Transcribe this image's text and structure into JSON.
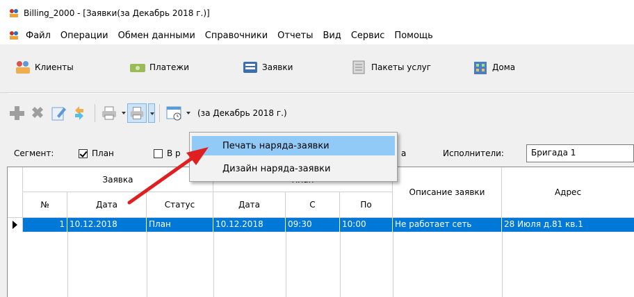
{
  "window": {
    "title": "Billing_2000 - [Заявки(за Декабрь 2018 г.)]"
  },
  "menu": [
    "Файл",
    "Операции",
    "Обмен данными",
    "Справочники",
    "Отчеты",
    "Вид",
    "Сервис",
    "Помощь"
  ],
  "mainbar": [
    {
      "label": "Клиенты",
      "icon": "clients-icon"
    },
    {
      "label": "Платежи",
      "icon": "payments-icon"
    },
    {
      "label": "Заявки",
      "icon": "requests-icon"
    },
    {
      "label": "Пакеты услуг",
      "icon": "service-packages-icon"
    },
    {
      "label": "Дома",
      "icon": "houses-icon"
    }
  ],
  "toolbar": {
    "period": "(за Декабрь 2018 г.)"
  },
  "filter": {
    "segment_label": "Сегмент:",
    "plan_label": "План",
    "plan_checked": true,
    "second_label": "В р",
    "second_checked": false,
    "partial_right": "а",
    "executors_label": "Исполнители:",
    "executors_value": "Бригада 1"
  },
  "popup": {
    "items": [
      "Печать наряда-заявки",
      "Дизайн наряда-заявки"
    ],
    "highlighted": 0
  },
  "grid": {
    "group_headers": [
      "Заявка",
      "План"
    ],
    "headers": [
      "№",
      "Дата",
      "Статус",
      "Дата",
      "С",
      "По",
      "Описание заявки",
      "Адрес"
    ],
    "rows": [
      [
        "1",
        "10.12.2018",
        "План",
        "10.12.2018",
        "09:30",
        "10:00",
        "Не работает сеть",
        "28 Июля д.81 кв.1"
      ]
    ]
  },
  "colors": {
    "selection": "#0078d7",
    "menu_highlight": "#91c9f7",
    "arrow": "#e02020"
  }
}
